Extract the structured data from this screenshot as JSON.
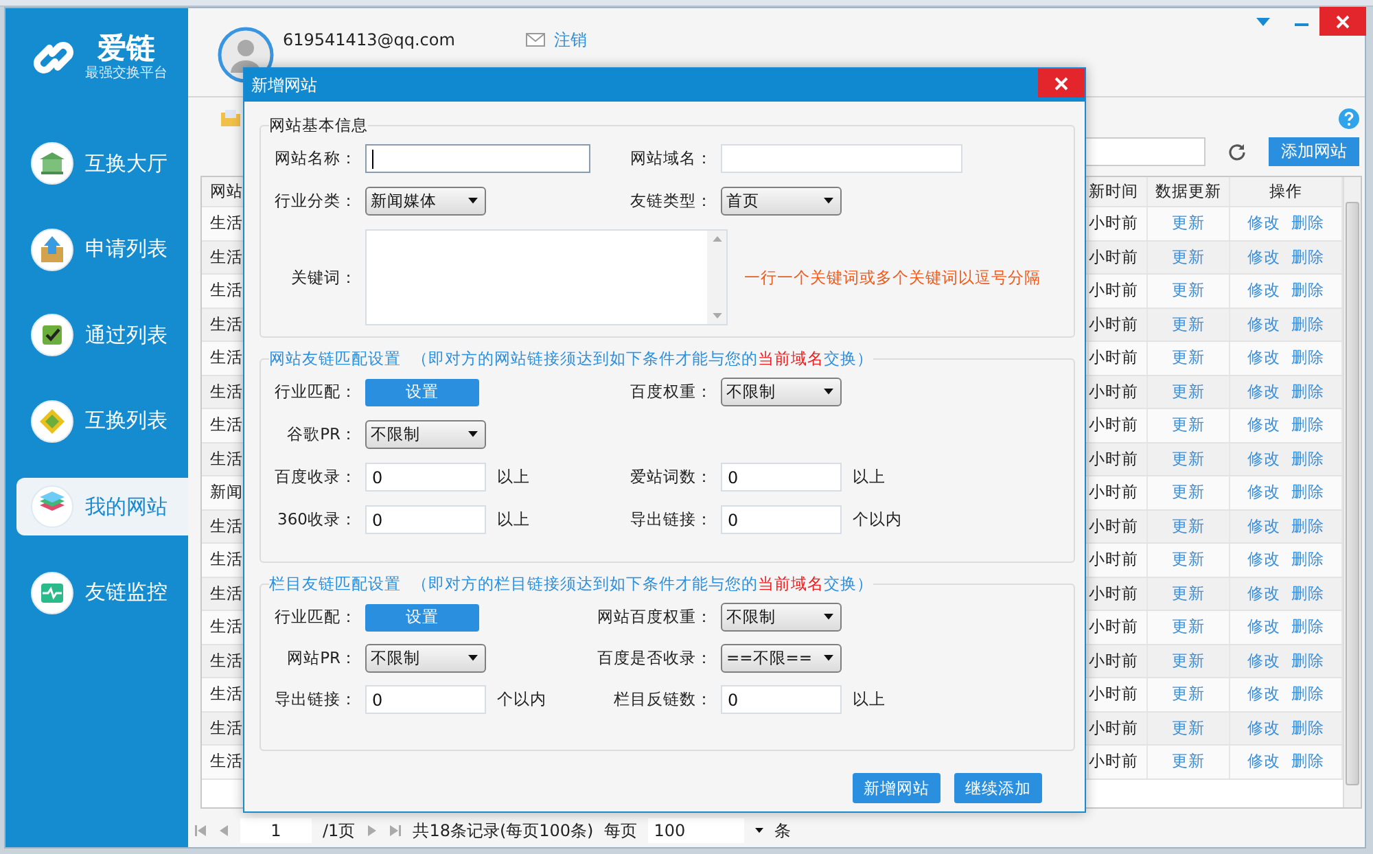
{
  "sidebar": {
    "logo": {
      "title": "爱链",
      "subtitle": "最强交换平台"
    },
    "items": [
      {
        "label": "互换大厅",
        "selected": false
      },
      {
        "label": "申请列表",
        "selected": false
      },
      {
        "label": "通过列表",
        "selected": false
      },
      {
        "label": "互换列表",
        "selected": false
      },
      {
        "label": "我的网站",
        "selected": true
      },
      {
        "label": "友链监控",
        "selected": false
      }
    ]
  },
  "header": {
    "email": "619541413@qq.com",
    "logout": "注销"
  },
  "toolbar": {
    "add_button": "添加网站"
  },
  "table": {
    "columns": [
      "网站",
      "新时间",
      "数据更新",
      "操作"
    ],
    "rows": [
      {
        "site": "生活",
        "time": "小时前",
        "update": "更新",
        "actions": [
          "修改",
          "删除"
        ]
      },
      {
        "site": "生活",
        "time": "小时前",
        "update": "更新",
        "actions": [
          "修改",
          "删除"
        ]
      },
      {
        "site": "生活",
        "time": "小时前",
        "update": "更新",
        "actions": [
          "修改",
          "删除"
        ]
      },
      {
        "site": "生活",
        "time": "小时前",
        "update": "更新",
        "actions": [
          "修改",
          "删除"
        ]
      },
      {
        "site": "生活",
        "time": "小时前",
        "update": "更新",
        "actions": [
          "修改",
          "删除"
        ]
      },
      {
        "site": "生活",
        "time": "小时前",
        "update": "更新",
        "actions": [
          "修改",
          "删除"
        ]
      },
      {
        "site": "生活",
        "time": "小时前",
        "update": "更新",
        "actions": [
          "修改",
          "删除"
        ]
      },
      {
        "site": "生活",
        "time": "小时前",
        "update": "更新",
        "actions": [
          "修改",
          "删除"
        ]
      },
      {
        "site": "新闻",
        "time": "小时前",
        "update": "更新",
        "actions": [
          "修改",
          "删除"
        ]
      },
      {
        "site": "生活",
        "time": "小时前",
        "update": "更新",
        "actions": [
          "修改",
          "删除"
        ]
      },
      {
        "site": "生活",
        "time": "小时前",
        "update": "更新",
        "actions": [
          "修改",
          "删除"
        ]
      },
      {
        "site": "生活",
        "time": "小时前",
        "update": "更新",
        "actions": [
          "修改",
          "删除"
        ]
      },
      {
        "site": "生活",
        "time": "小时前",
        "update": "更新",
        "actions": [
          "修改",
          "删除"
        ]
      },
      {
        "site": "生活",
        "time": "小时前",
        "update": "更新",
        "actions": [
          "修改",
          "删除"
        ]
      },
      {
        "site": "生活",
        "time": "小时前",
        "update": "更新",
        "actions": [
          "修改",
          "删除"
        ]
      },
      {
        "site": "生活",
        "time": "小时前",
        "update": "更新",
        "actions": [
          "修改",
          "删除"
        ]
      },
      {
        "site": "生活",
        "time": "小时前",
        "update": "更新",
        "actions": [
          "修改",
          "删除"
        ]
      }
    ]
  },
  "pager": {
    "page": "1",
    "total_pages": "/1页",
    "summary": "共18条记录(每页100条)",
    "per_page_label": "每页",
    "per_page": "100",
    "unit": "条"
  },
  "dialog": {
    "title": "新增网站",
    "sections": [
      {
        "title": "网站基本信息",
        "rows": [
          [
            {
              "label": "网站名称：",
              "kind": "input",
              "focused": true
            },
            {
              "label": "网站域名：",
              "kind": "input",
              "focused": false
            }
          ],
          [
            {
              "label": "行业分类：",
              "kind": "select",
              "value": "新闻媒体"
            },
            {
              "label": "友链类型：",
              "kind": "select",
              "value": "首页"
            }
          ],
          [
            {
              "label": "关键词：",
              "kind": "textarea",
              "hint": "一行一个关键词或多个关键词以逗号分隔"
            }
          ]
        ]
      },
      {
        "title": "网站友链匹配设置",
        "note": [
          "（即对方的网站链接须达到如下条件才能与您的",
          "当前域名",
          "交换）"
        ],
        "rows": [
          [
            {
              "label": "行业匹配：",
              "kind": "button",
              "value": "设置"
            },
            {
              "label": "百度权重：",
              "kind": "select",
              "value": "不限制"
            }
          ],
          [
            {
              "label": "谷歌PR：",
              "kind": "select",
              "value": "不限制"
            }
          ],
          [
            {
              "label": "百度收录：",
              "kind": "small_input",
              "value": "0",
              "suffix": "以上"
            },
            {
              "label": "爱站词数：",
              "kind": "small_input",
              "value": "0",
              "suffix": "以上"
            }
          ],
          [
            {
              "label": "360收录：",
              "kind": "small_input",
              "value": "0",
              "suffix": "以上"
            },
            {
              "label": "导出链接：",
              "kind": "small_input",
              "value": "0",
              "suffix": "个以内"
            }
          ]
        ]
      },
      {
        "title": "栏目友链匹配设置",
        "note": [
          "（即对方的栏目链接须达到如下条件才能与您的",
          "当前域名",
          "交换）"
        ],
        "rows": [
          [
            {
              "label": "行业匹配：",
              "kind": "button",
              "value": "设置"
            },
            {
              "label": "网站百度权重：",
              "kind": "select",
              "value": "不限制"
            }
          ],
          [
            {
              "label": "网站PR：",
              "kind": "select",
              "value": "不限制"
            },
            {
              "label": "百度是否收录：",
              "kind": "select",
              "value": "==不限=="
            }
          ],
          [
            {
              "label": "导出链接：",
              "kind": "small_input",
              "value": "0",
              "suffix": "个以内"
            },
            {
              "label": "栏目反链数：",
              "kind": "small_input",
              "value": "0",
              "suffix": "以上"
            }
          ]
        ]
      }
    ],
    "buttons": [
      "新增网站",
      "继续添加"
    ]
  }
}
